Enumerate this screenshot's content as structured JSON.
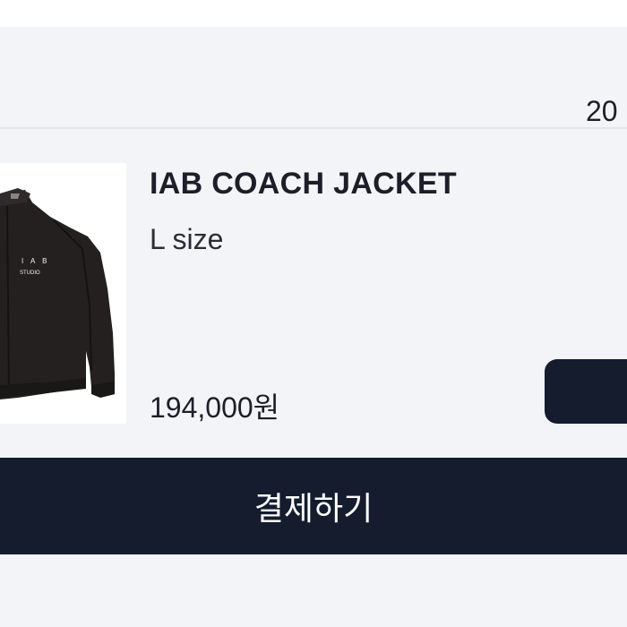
{
  "header": {
    "date_partial": "20"
  },
  "product": {
    "image_icon": "jacket-photo",
    "image_print": "I A B STUDIO",
    "title": "IAB COACH JACKET",
    "option": "L size",
    "price": "194,000원"
  },
  "side_button": {
    "label": "",
    "color": "#141c2e"
  },
  "checkout": {
    "label": "결제하기",
    "color": "#141c2e"
  },
  "colors": {
    "background": "#f3f4f7",
    "text": "#1c1f2a"
  }
}
